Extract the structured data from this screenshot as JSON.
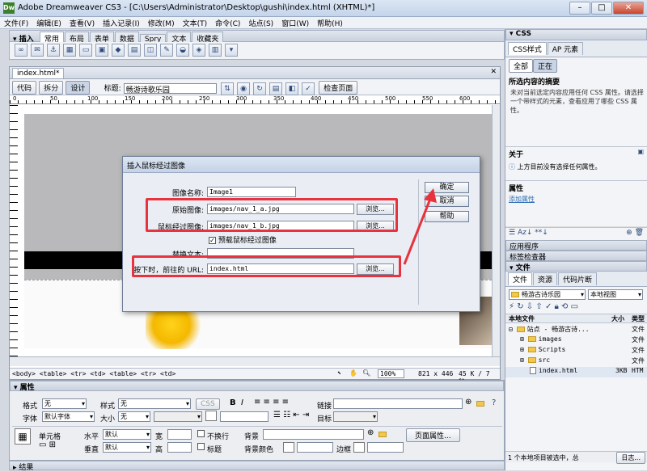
{
  "window": {
    "title": "Adobe Dreamweaver CS3 - [C:\\Users\\Administrator\\Desktop\\gushi\\index.html (XHTML)*]",
    "app_icon": "Dw"
  },
  "menu": [
    "文件(F)",
    "编辑(E)",
    "查看(V)",
    "插入记录(I)",
    "修改(M)",
    "文本(T)",
    "命令(C)",
    "站点(S)",
    "窗口(W)",
    "帮助(H)"
  ],
  "insert_bar": {
    "label": "▾ 插入",
    "tabs": [
      "常用",
      "布局",
      "表单",
      "数据",
      "Spry",
      "文本",
      "收藏夹"
    ]
  },
  "document": {
    "tab": "index.html*",
    "view_buttons": [
      "代码",
      "拆分",
      "设计"
    ],
    "title_label": "标题:",
    "title_value": "畅游诗歌乐园",
    "check_page": "检查页面",
    "tag_selector": "<body> <table> <tr> <td> <table> <tr> <td>",
    "zoom": "100%",
    "dimensions": "821 x 446",
    "size_time": "45 K / 7 秒"
  },
  "ruler_ticks": [
    "0",
    "50",
    "100",
    "150",
    "200",
    "250",
    "300",
    "350",
    "400",
    "450",
    "500",
    "550",
    "600"
  ],
  "dialog": {
    "caption": "插入鼠标经过图像",
    "fields": [
      {
        "label": "图像名称:",
        "value": "Image1"
      },
      {
        "label": "原始图像:",
        "value": "images/nav_1_a.jpg"
      },
      {
        "label": "鼠标经过图像:",
        "value": "images/nav_1_b.jpg"
      },
      {
        "label": "替换文本:",
        "value": ""
      },
      {
        "label": "按下时，前往的 URL:",
        "value": "index.html"
      }
    ],
    "preload_label": "预载鼠标经过图像",
    "browse": "浏览...",
    "ok": "确定",
    "cancel": "取消",
    "help": "帮助"
  },
  "css_panel": {
    "header": "▾ CSS",
    "tabs": [
      "CSS样式",
      "AP 元素"
    ],
    "modes": [
      "全部",
      "正在"
    ],
    "summary_title": "所选内容的摘要",
    "summary_text": "未对当前选定内容应用任何 CSS 属性。请选择一个带样式的元素，查看应用了哪些 CSS 属性。",
    "about_title": "关于",
    "about_text": "上方目前没有选择任何属性。",
    "props_title": "属性",
    "add_prop": "添加属性"
  },
  "collapsed_panels": [
    "应用程序",
    "标签检查器"
  ],
  "files_panel": {
    "header": "▾ 文件",
    "tabs": [
      "文件",
      "资源",
      "代码片断"
    ],
    "site": "畅游古诗乐园",
    "view": "本地视图",
    "cols": [
      "本地文件",
      "大小",
      "类型"
    ],
    "items": [
      {
        "name": "站点 - 畅游古诗...",
        "type": "文件"
      },
      {
        "name": "images",
        "type": "文件"
      },
      {
        "name": "Scripts",
        "type": "文件"
      },
      {
        "name": "src",
        "type": "文件"
      },
      {
        "name": "index.html",
        "size": "3KB",
        "type": "HTM"
      }
    ],
    "status": "1 个本地项目被选中，总",
    "log": "日志..."
  },
  "properties": {
    "header": "▾ 属性",
    "format_label": "格式",
    "format_value": "无",
    "style_label": "样式",
    "style_value": "无",
    "css_btn": "CSS",
    "link_label": "链接",
    "font_label": "字体",
    "font_value": "默认字体",
    "size_label": "大小",
    "size_value": "无",
    "target_label": "目标",
    "cell_label": "单元格",
    "horz_label": "水平",
    "horz_value": "默认",
    "vert_label": "垂直",
    "vert_value": "默认",
    "width_label": "宽",
    "height_label": "高",
    "nowrap_label": "不换行",
    "header_label": "标题",
    "bg_label": "背景",
    "bgcolor_label": "背景颜色",
    "border_label": "边框",
    "page_props": "页面属性..."
  },
  "results": "▸ 结果"
}
